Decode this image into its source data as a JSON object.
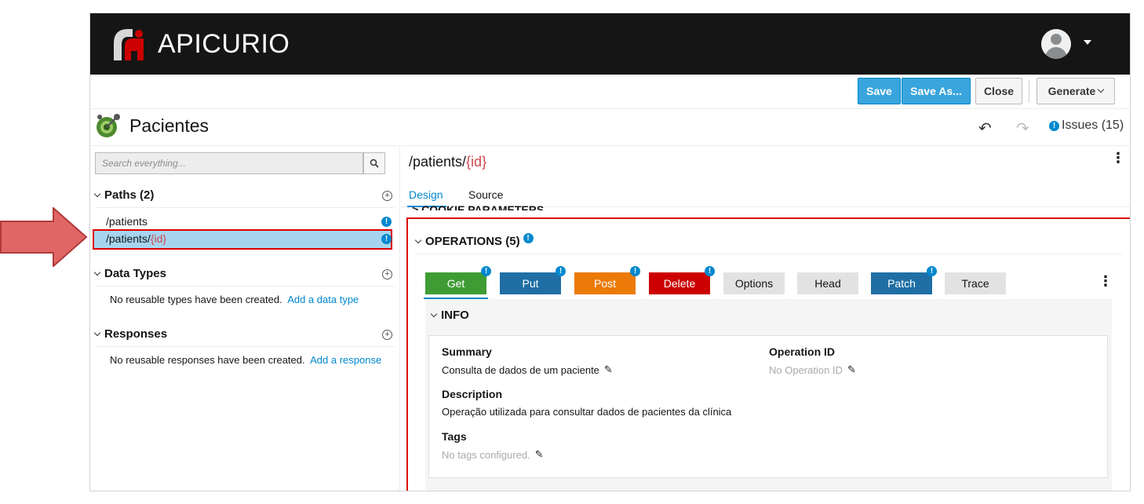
{
  "app": {
    "brand": "APICURIO"
  },
  "toolbar": {
    "save": "Save",
    "save_as": "Save As...",
    "close": "Close",
    "generate": "Generate"
  },
  "api": {
    "title": "Pacientes"
  },
  "issues": {
    "label": "Issues (15)"
  },
  "sidebar": {
    "search_placeholder": "Search everything...",
    "paths_header": "Paths (2)",
    "paths": [
      {
        "prefix": "/patients",
        "param": ""
      },
      {
        "prefix": "/patients/",
        "param": "{id}"
      }
    ],
    "data_types_header": "Data Types",
    "data_types_empty": "No reusable types have been created.",
    "data_types_link": "Add a data type",
    "responses_header": "Responses",
    "responses_empty": "No reusable responses have been created.",
    "responses_link": "Add a response"
  },
  "main": {
    "path_prefix": "/patients/",
    "path_param": "{id}",
    "tabs": [
      "Design",
      "Source"
    ],
    "cookie_section": "COOKIE PARAMETERS",
    "operations_header": "OPERATIONS (5)",
    "operations": [
      "Get",
      "Put",
      "Post",
      "Delete",
      "Options",
      "Head",
      "Patch",
      "Trace"
    ],
    "info_header": "INFO",
    "info": {
      "summary_label": "Summary",
      "summary_value": "Consulta de dados de um paciente",
      "operation_id_label": "Operation ID",
      "operation_id_value": "No Operation ID",
      "description_label": "Description",
      "description_value": "Operação utilizada para consultar dados de pacientes da clínica",
      "tags_label": "Tags",
      "tags_value": "No tags configured."
    }
  },
  "colors": {
    "accent": "#0088ce",
    "highlight": "#d00000",
    "arrow": "#e06666"
  }
}
